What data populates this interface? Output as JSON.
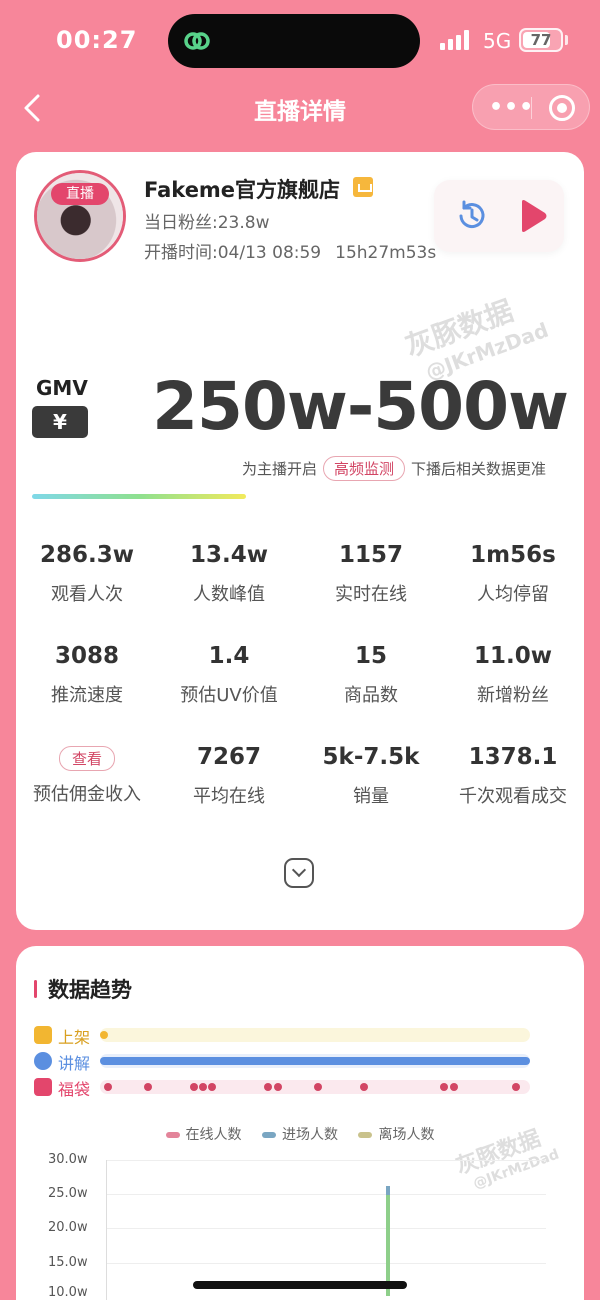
{
  "status": {
    "time": "00:27",
    "network": "5G",
    "battery": "77",
    "battery_level": 0.77
  },
  "nav": {
    "title": "直播详情"
  },
  "shop": {
    "live_tag": "直播",
    "name": "Fakeme官方旗舰店",
    "fans": "当日粉丝:23.8w",
    "start_time": "开播时间:04/13 08:59",
    "duration": "15h27m53s"
  },
  "watermark": {
    "brand": "灰豚数据",
    "id": "@JKrMzDad"
  },
  "gmv": {
    "label": "GMV",
    "currency": "¥",
    "value": "250w-500w",
    "note_before": "为主播开启",
    "note_pill": "高频监测",
    "note_after": "下播后相关数据更准"
  },
  "metrics": [
    {
      "value": "286.3w",
      "label": "观看人次"
    },
    {
      "value": "13.4w",
      "label": "人数峰值"
    },
    {
      "value": "1157",
      "label": "实时在线"
    },
    {
      "value": "1m56s",
      "label": "人均停留"
    },
    {
      "value": "3088",
      "label": "推流速度"
    },
    {
      "value": "1.4",
      "label": "预估UV价值"
    },
    {
      "value": "15",
      "label": "商品数"
    },
    {
      "value": "11.0w",
      "label": "新增粉丝"
    },
    {
      "value": "查看",
      "label": "预估佣金收入"
    },
    {
      "value": "7267",
      "label": "平均在线"
    },
    {
      "value": "5k-7.5k",
      "label": "销量"
    },
    {
      "value": "1378.1",
      "label": "千次观看成交"
    }
  ],
  "trend": {
    "title": "数据趋势",
    "rows": [
      {
        "label": "上架",
        "color": "#f2b631"
      },
      {
        "label": "讲解",
        "color": "#5b8fe0"
      },
      {
        "label": "福袋",
        "color": "#e3466c"
      }
    ],
    "legend": [
      {
        "label": "在线人数",
        "color": "#e3849a"
      },
      {
        "label": "进场人数",
        "color": "#7aa6c2"
      },
      {
        "label": "离场人数",
        "color": "#c9c28c"
      }
    ],
    "yticks": [
      "30.0w",
      "25.0w",
      "20.0w",
      "15.0w",
      "10.0w"
    ]
  }
}
